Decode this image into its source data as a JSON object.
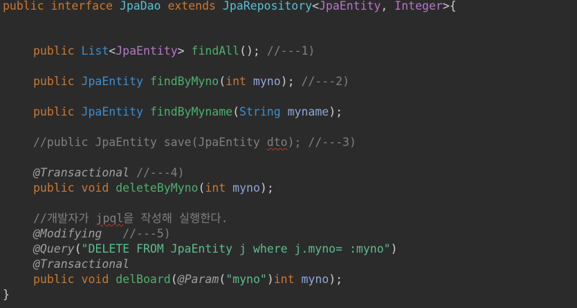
{
  "code": {
    "l1": {
      "public": "public",
      "interface": "interface",
      "name": "JpaDao",
      "extends": "extends",
      "repo": "JpaRepository",
      "lt": "<",
      "entity": "JpaEntity",
      "comma": ", ",
      "integer": "Integer",
      "gt": ">",
      "brace": "{"
    },
    "l2": {
      "public": "public",
      "list": "List",
      "lt": "<",
      "entity": "JpaEntity",
      "gt": "> ",
      "method": "findAll",
      "parens": "();",
      "comment": " //---1)"
    },
    "l3": {
      "public": "public",
      "ret": "JpaEntity",
      "method": "findByMyno",
      "open": "(",
      "ptype": "int",
      "pname": "myno",
      "close": ");",
      "comment": " //---2)"
    },
    "l4": {
      "public": "public",
      "ret": "JpaEntity",
      "method": "findByMyname",
      "open": "(",
      "ptype": "String",
      "pname": "myname",
      "close": ");"
    },
    "l5": {
      "text_a": "//public JpaEntity save(JpaEntity ",
      "text_dto": "dto",
      "text_b": "); //---3)"
    },
    "l6": {
      "anno": "@Transactional",
      "comment": " //---4)"
    },
    "l7": {
      "public": "public",
      "void": "void",
      "method": "deleteByMyno",
      "open": "(",
      "ptype": "int",
      "pname": "myno",
      "close": ");"
    },
    "l8": {
      "text_a": "//개발자가 ",
      "text_jpql": "jpql",
      "text_b": "을 작성해 실행한다."
    },
    "l9": {
      "anno": "@Modifying",
      "comment": "   //---5)"
    },
    "l10": {
      "anno": "@Query",
      "open": "(",
      "str": "\"DELETE FROM JpaEntity j where j.myno= :myno\"",
      "close": ")"
    },
    "l11": {
      "anno": "@Transactional"
    },
    "l12": {
      "public": "public",
      "void": "void",
      "method": "delBoard",
      "open": "(",
      "panno": "@Param",
      "popen": "(",
      "pstr": "\"myno\"",
      "pclose": ")",
      "ptype": "int",
      "pname": "myno",
      "close": ");"
    },
    "l13": {
      "brace": "}"
    }
  }
}
